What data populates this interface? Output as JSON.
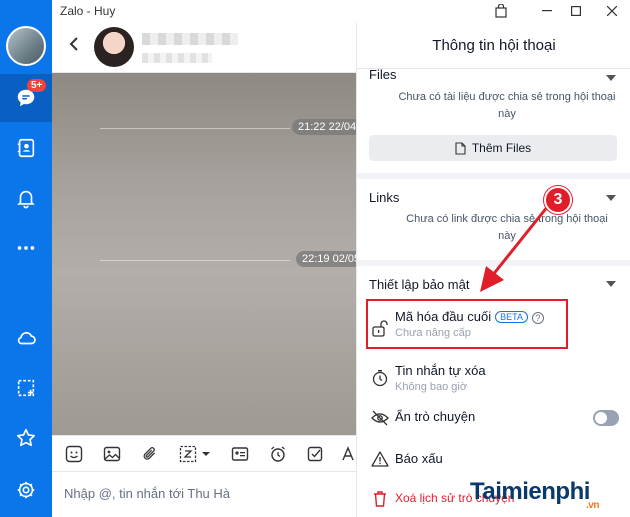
{
  "window": {
    "title": "Zalo - Huy"
  },
  "nav": {
    "messages_badge": "5+"
  },
  "chat": {
    "timestamps": [
      "21:22 22/04",
      "22:19 02/05"
    ],
    "composer_placeholder": "Nhập @, tin nhắn tới Thu Hà"
  },
  "panel": {
    "title": "Thông tin hội thoại",
    "files": {
      "title": "Files",
      "empty": "Chưa có tài liệu được chia sẻ trong hội thoại này",
      "add_label": "Thêm Files"
    },
    "links": {
      "title": "Links",
      "empty": "Chưa có link được chia sẻ trong hội thoại này"
    },
    "security": {
      "title": "Thiết lập bảo mật",
      "e2ee_label": "Mã hóa đầu cuối",
      "e2ee_badge": "BETA",
      "e2ee_sub": "Chưa nâng cấp",
      "self_destruct_label": "Tin nhắn tự xóa",
      "self_destruct_sub": "Không bao giờ",
      "hide_label": "Ẩn trò chuyện",
      "hide_enabled": false,
      "report_label": "Báo xấu",
      "delete_label": "Xoá lịch sử trò chuyện"
    }
  },
  "annotation": {
    "step": "3",
    "color": "#e11d2a"
  },
  "watermark": {
    "text": "Taimienphi",
    "suffix": ".vn"
  }
}
